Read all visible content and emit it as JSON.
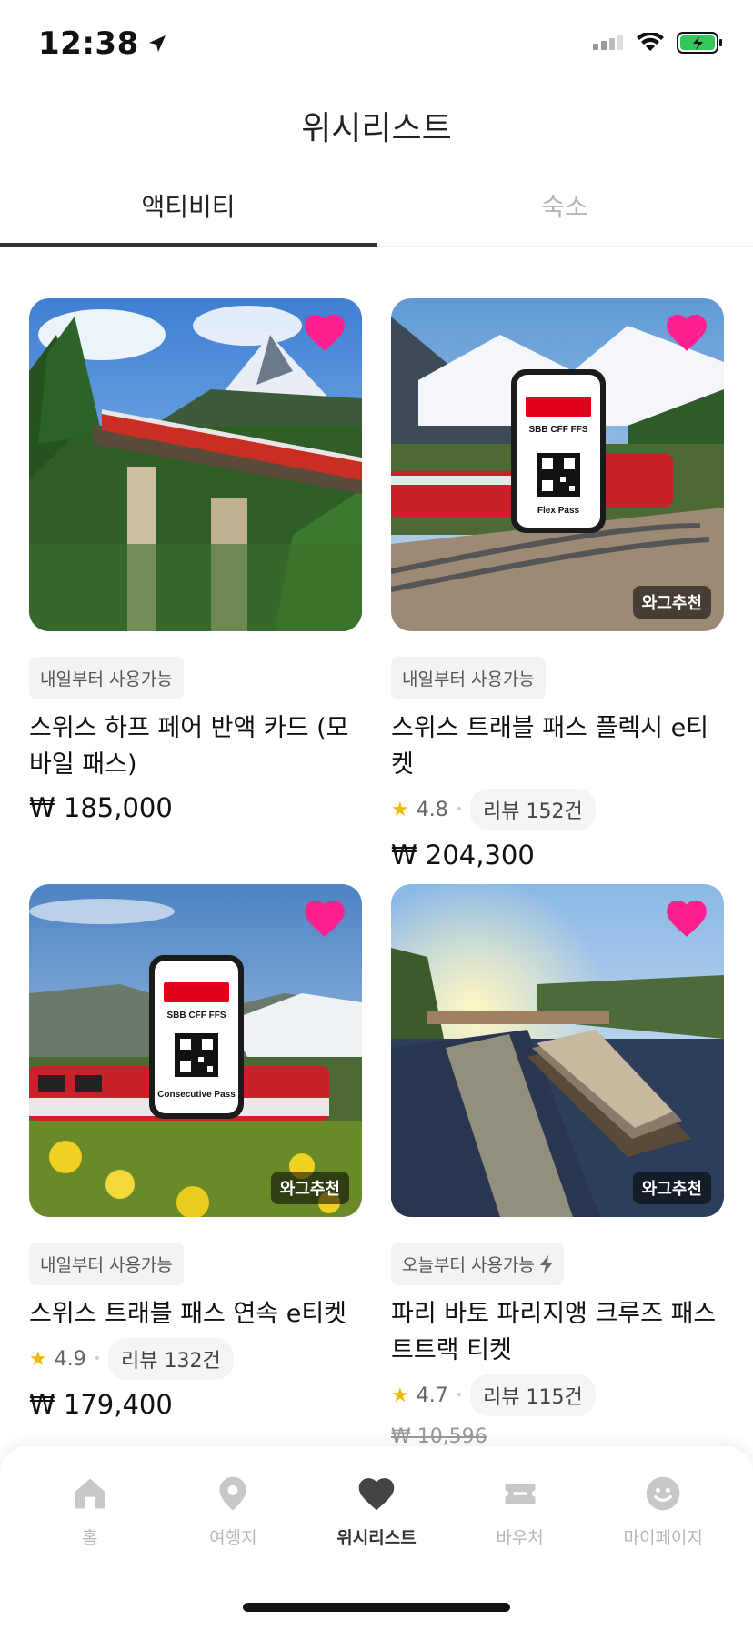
{
  "status": {
    "time": "12:38"
  },
  "header": {
    "title": "위시리스트"
  },
  "tabs": [
    {
      "label": "액티비티",
      "active": true
    },
    {
      "label": "숙소",
      "active": false
    }
  ],
  "cards": [
    {
      "tag": "내일부터 사용가능",
      "title": "스위스 하프 페어 반액 카드 (모바일 패스)",
      "price": "₩ 185,000",
      "liked": true
    },
    {
      "tag": "내일부터 사용가능",
      "title": "스위스 트래블 패스 플렉시 e티켓",
      "rating": "4.8",
      "reviews": "리뷰 152건",
      "price": "₩ 204,300",
      "badge": "와그추천",
      "pass_brand": "SBB CFF FFS",
      "pass_name": "Flex Pass",
      "liked": true
    },
    {
      "tag": "내일부터 사용가능",
      "title": "스위스 트래블 패스 연속 e티켓",
      "rating": "4.9",
      "reviews": "리뷰 132건",
      "price": "₩ 179,400",
      "badge": "와그추천",
      "pass_brand": "SBB CFF FFS",
      "pass_name": "Consecutive Pass",
      "liked": true
    },
    {
      "tag": "오늘부터 사용가능",
      "title": "파리 바토 파리지앵 크루즈 패스 트트랙 티켓",
      "rating": "4.7",
      "reviews": "리뷰 115건",
      "price_strike": "₩ 10,596",
      "badge": "와그추천",
      "liked": true
    }
  ],
  "nav": [
    {
      "label": "홈",
      "icon": "home-icon",
      "active": false
    },
    {
      "label": "여행지",
      "icon": "location-pin-icon",
      "active": false
    },
    {
      "label": "위시리스트",
      "icon": "heart-icon",
      "active": true
    },
    {
      "label": "바우처",
      "icon": "ticket-icon",
      "active": false
    },
    {
      "label": "마이페이지",
      "icon": "smiley-icon",
      "active": false
    }
  ],
  "colors": {
    "heart": "#ff1f8e",
    "star": "#f5b800",
    "active_tab": "#333333"
  }
}
